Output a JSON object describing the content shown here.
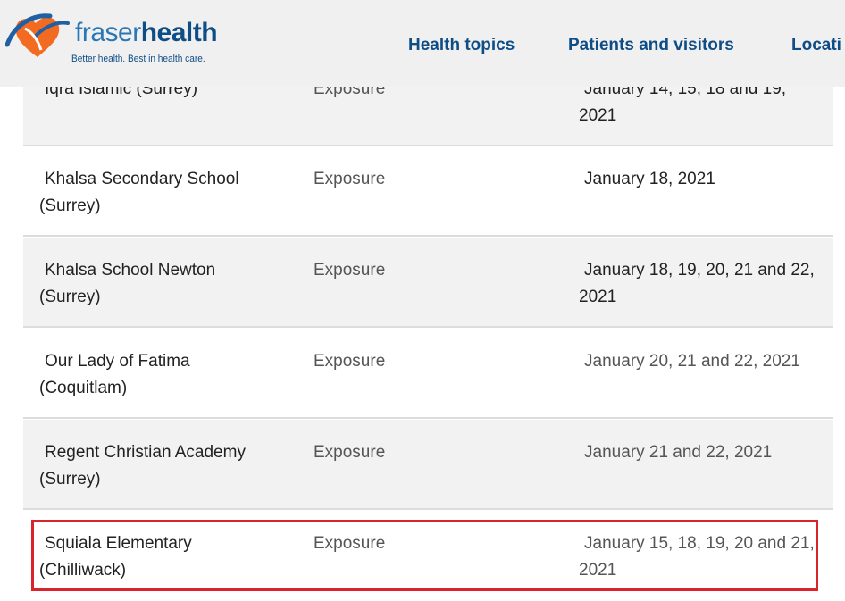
{
  "header": {
    "logo_word_a": "fraser",
    "logo_word_b": "health",
    "logo_tagline": "Better health. Best in health care.",
    "nav": [
      {
        "label": "Health topics"
      },
      {
        "label": "Patients and visitors"
      },
      {
        "label": "Locati"
      }
    ]
  },
  "table": {
    "rows": [
      {
        "name": "Iqra Islamic (Surrey)",
        "type": "Exposure",
        "dates": "January 14, 15, 18 and 19, 2021"
      },
      {
        "name": "Khalsa Secondary School (Surrey)",
        "type": "Exposure",
        "dates": "January 18, 2021"
      },
      {
        "name": "Khalsa School Newton (Surrey)",
        "type": "Exposure",
        "dates": "January 18, 19, 20, 21 and 22, 2021"
      },
      {
        "name": "Our Lady of Fatima (Coquitlam)",
        "type": "Exposure",
        "dates": "January 20, 21 and 22, 2021"
      },
      {
        "name": "Regent Christian Academy (Surrey)",
        "type": "Exposure",
        "dates": "January 21 and 22, 2021"
      },
      {
        "name": "Squiala Elementary (Chilliwack)",
        "type": "Exposure",
        "dates": "January 15, 18, 19, 20 and 21,  2021"
      }
    ]
  },
  "colors": {
    "brand_blue": "#0e4d86",
    "brand_orange": "#f26b21",
    "highlight_red": "#d9242b"
  }
}
